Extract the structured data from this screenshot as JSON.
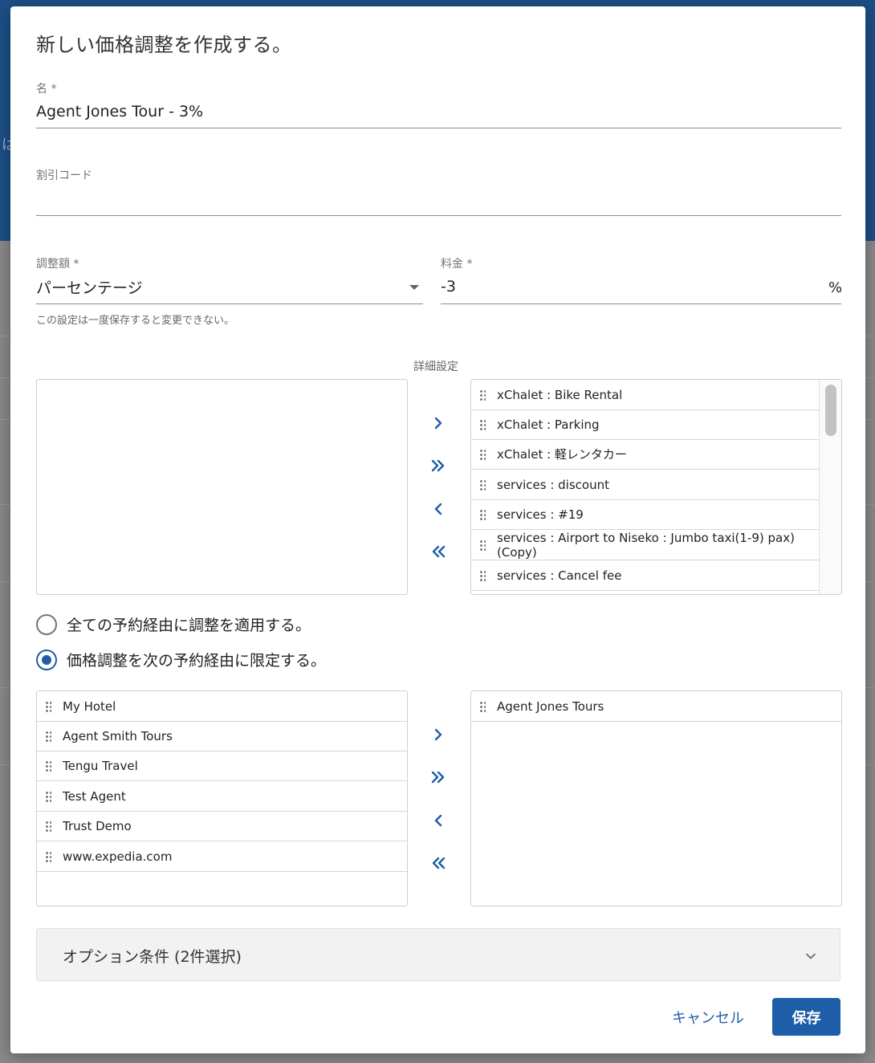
{
  "background": {
    "glyph": "は"
  },
  "dialog": {
    "title": "新しい価格調整を作成する。",
    "name": {
      "label": "名 *",
      "value": "Agent Jones Tour - 3%"
    },
    "discount_code": {
      "label": "割引コード",
      "value": ""
    },
    "adjustment": {
      "label": "調整額 *",
      "value": "パーセンテージ",
      "helper": "この設定は一度保存すると変更できない。"
    },
    "fee": {
      "label": "料金 *",
      "value": "-3",
      "suffix": "%"
    },
    "advanced_label": "詳細設定",
    "items_available": [],
    "items_selected": [
      "xChalet : Bike Rental",
      "xChalet : Parking",
      "xChalet : 軽レンタカー",
      "services : discount",
      "services : #19",
      "services : Airport to Niseko : Jumbo taxi(1-9) pax)\n(Copy)",
      "services : Cancel fee"
    ],
    "radio_all": "全ての予約経由に調整を適用する。",
    "radio_limit": "価格調整を次の予約経由に限定する。",
    "channels_available": [
      "My Hotel",
      "Agent Smith Tours",
      "Tengu Travel",
      "Test Agent",
      "Trust Demo",
      "www.expedia.com"
    ],
    "channels_selected": [
      "Agent Jones Tours"
    ],
    "options_title": "オプション条件 (2件選択)",
    "cancel_label": "キャンセル",
    "save_label": "保存"
  },
  "icons": {
    "move_right": "chevron-right-icon",
    "move_all_right": "double-chevron-right-icon",
    "move_left": "chevron-left-icon",
    "move_all_left": "double-chevron-left-icon",
    "expand": "chevron-down-icon",
    "drag": "drag-handle-icon"
  },
  "colors": {
    "primary": "#1e5ea8",
    "header_bg": "#1c4f86"
  }
}
